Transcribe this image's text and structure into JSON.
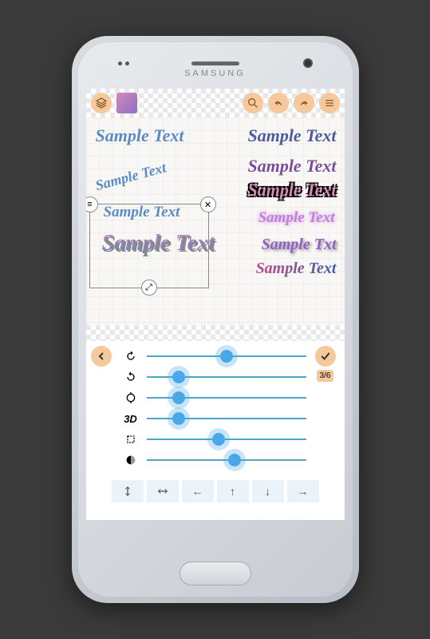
{
  "brand": "SAMSUNG",
  "samples": {
    "s1": "Sample Text",
    "s2": "Sample Text",
    "s3": "Sample Text",
    "s4": "Sample Text",
    "s5": "Sample Text",
    "s6": "Sample Text",
    "s7": "Sample Text",
    "s8": "Sample\nText",
    "s9": "Sample Txt",
    "s10": "Sample Text"
  },
  "sliders": [
    {
      "icon": "rotate-ccw",
      "value": 50
    },
    {
      "icon": "rotate-cw",
      "value": 20
    },
    {
      "icon": "rotate-loop",
      "value": 20
    },
    {
      "icon": "3D",
      "value": 20
    },
    {
      "icon": "crop",
      "value": 45
    },
    {
      "icon": "fade-circle",
      "value": 55
    }
  ],
  "step": "3/6",
  "arrows": [
    "center-v",
    "center-h",
    "left",
    "up",
    "down",
    "right"
  ]
}
